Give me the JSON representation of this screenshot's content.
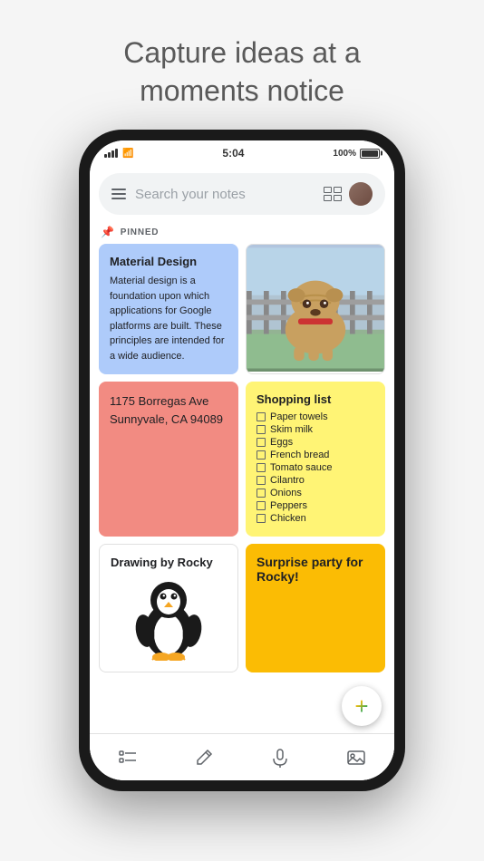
{
  "page": {
    "headline_line1": "Capture ideas at a",
    "headline_line2": "moments notice"
  },
  "status_bar": {
    "time": "5:04",
    "battery_percent": "100%"
  },
  "search_bar": {
    "placeholder": "Search your notes"
  },
  "pinned_section": {
    "label": "PINNED"
  },
  "notes": [
    {
      "id": "material-design",
      "color": "blue",
      "title": "Material Design",
      "body": "Material design is a foundation upon which applications for Google platforms are built. These principles are intended for a wide audience."
    },
    {
      "id": "dog-photo",
      "color": "image",
      "title": "",
      "body": ""
    },
    {
      "id": "address",
      "color": "pink",
      "title": "",
      "body": "1175 Borregas Ave Sunnyvale, CA 94089"
    },
    {
      "id": "shopping-list",
      "color": "yellow",
      "title": "Shopping list",
      "items": [
        "Paper towels",
        "Skim milk",
        "Eggs",
        "French bread",
        "Tomato sauce",
        "Cilantro",
        "Onions",
        "Peppers",
        "Chicken"
      ]
    },
    {
      "id": "drawing-rocky",
      "color": "white",
      "title": "Drawing by Rocky",
      "body": ""
    },
    {
      "id": "surprise-party",
      "color": "orange",
      "title": "Surprise party for Rocky!",
      "body": ""
    }
  ],
  "toolbar": {
    "items": [
      "checkmark",
      "pencil",
      "microphone",
      "image"
    ]
  },
  "colors": {
    "blue_note": "#aecbfa",
    "pink_note": "#f28b82",
    "yellow_note": "#fff475",
    "orange_note": "#fbbc04",
    "white_note": "#ffffff",
    "accent": "#1a73e8"
  }
}
